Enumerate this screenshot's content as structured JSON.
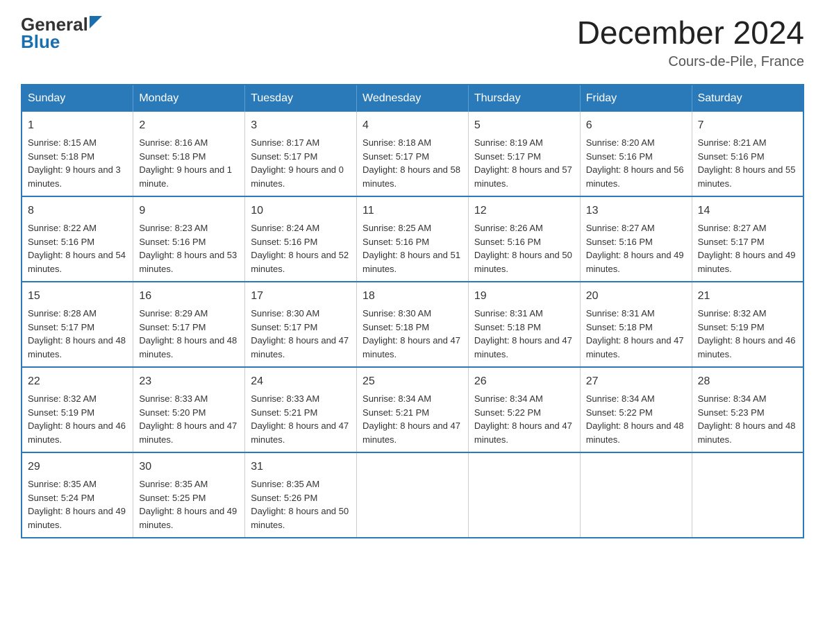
{
  "logo": {
    "general": "General",
    "blue": "Blue",
    "arrow": "▶"
  },
  "title": "December 2024",
  "subtitle": "Cours-de-Pile, France",
  "days_of_week": [
    "Sunday",
    "Monday",
    "Tuesday",
    "Wednesday",
    "Thursday",
    "Friday",
    "Saturday"
  ],
  "weeks": [
    [
      {
        "day": "1",
        "sunrise": "8:15 AM",
        "sunset": "5:18 PM",
        "daylight": "9 hours and 3 minutes."
      },
      {
        "day": "2",
        "sunrise": "8:16 AM",
        "sunset": "5:18 PM",
        "daylight": "9 hours and 1 minute."
      },
      {
        "day": "3",
        "sunrise": "8:17 AM",
        "sunset": "5:17 PM",
        "daylight": "9 hours and 0 minutes."
      },
      {
        "day": "4",
        "sunrise": "8:18 AM",
        "sunset": "5:17 PM",
        "daylight": "8 hours and 58 minutes."
      },
      {
        "day": "5",
        "sunrise": "8:19 AM",
        "sunset": "5:17 PM",
        "daylight": "8 hours and 57 minutes."
      },
      {
        "day": "6",
        "sunrise": "8:20 AM",
        "sunset": "5:16 PM",
        "daylight": "8 hours and 56 minutes."
      },
      {
        "day": "7",
        "sunrise": "8:21 AM",
        "sunset": "5:16 PM",
        "daylight": "8 hours and 55 minutes."
      }
    ],
    [
      {
        "day": "8",
        "sunrise": "8:22 AM",
        "sunset": "5:16 PM",
        "daylight": "8 hours and 54 minutes."
      },
      {
        "day": "9",
        "sunrise": "8:23 AM",
        "sunset": "5:16 PM",
        "daylight": "8 hours and 53 minutes."
      },
      {
        "day": "10",
        "sunrise": "8:24 AM",
        "sunset": "5:16 PM",
        "daylight": "8 hours and 52 minutes."
      },
      {
        "day": "11",
        "sunrise": "8:25 AM",
        "sunset": "5:16 PM",
        "daylight": "8 hours and 51 minutes."
      },
      {
        "day": "12",
        "sunrise": "8:26 AM",
        "sunset": "5:16 PM",
        "daylight": "8 hours and 50 minutes."
      },
      {
        "day": "13",
        "sunrise": "8:27 AM",
        "sunset": "5:16 PM",
        "daylight": "8 hours and 49 minutes."
      },
      {
        "day": "14",
        "sunrise": "8:27 AM",
        "sunset": "5:17 PM",
        "daylight": "8 hours and 49 minutes."
      }
    ],
    [
      {
        "day": "15",
        "sunrise": "8:28 AM",
        "sunset": "5:17 PM",
        "daylight": "8 hours and 48 minutes."
      },
      {
        "day": "16",
        "sunrise": "8:29 AM",
        "sunset": "5:17 PM",
        "daylight": "8 hours and 48 minutes."
      },
      {
        "day": "17",
        "sunrise": "8:30 AM",
        "sunset": "5:17 PM",
        "daylight": "8 hours and 47 minutes."
      },
      {
        "day": "18",
        "sunrise": "8:30 AM",
        "sunset": "5:18 PM",
        "daylight": "8 hours and 47 minutes."
      },
      {
        "day": "19",
        "sunrise": "8:31 AM",
        "sunset": "5:18 PM",
        "daylight": "8 hours and 47 minutes."
      },
      {
        "day": "20",
        "sunrise": "8:31 AM",
        "sunset": "5:18 PM",
        "daylight": "8 hours and 47 minutes."
      },
      {
        "day": "21",
        "sunrise": "8:32 AM",
        "sunset": "5:19 PM",
        "daylight": "8 hours and 46 minutes."
      }
    ],
    [
      {
        "day": "22",
        "sunrise": "8:32 AM",
        "sunset": "5:19 PM",
        "daylight": "8 hours and 46 minutes."
      },
      {
        "day": "23",
        "sunrise": "8:33 AM",
        "sunset": "5:20 PM",
        "daylight": "8 hours and 47 minutes."
      },
      {
        "day": "24",
        "sunrise": "8:33 AM",
        "sunset": "5:21 PM",
        "daylight": "8 hours and 47 minutes."
      },
      {
        "day": "25",
        "sunrise": "8:34 AM",
        "sunset": "5:21 PM",
        "daylight": "8 hours and 47 minutes."
      },
      {
        "day": "26",
        "sunrise": "8:34 AM",
        "sunset": "5:22 PM",
        "daylight": "8 hours and 47 minutes."
      },
      {
        "day": "27",
        "sunrise": "8:34 AM",
        "sunset": "5:22 PM",
        "daylight": "8 hours and 48 minutes."
      },
      {
        "day": "28",
        "sunrise": "8:34 AM",
        "sunset": "5:23 PM",
        "daylight": "8 hours and 48 minutes."
      }
    ],
    [
      {
        "day": "29",
        "sunrise": "8:35 AM",
        "sunset": "5:24 PM",
        "daylight": "8 hours and 49 minutes."
      },
      {
        "day": "30",
        "sunrise": "8:35 AM",
        "sunset": "5:25 PM",
        "daylight": "8 hours and 49 minutes."
      },
      {
        "day": "31",
        "sunrise": "8:35 AM",
        "sunset": "5:26 PM",
        "daylight": "8 hours and 50 minutes."
      },
      null,
      null,
      null,
      null
    ]
  ]
}
